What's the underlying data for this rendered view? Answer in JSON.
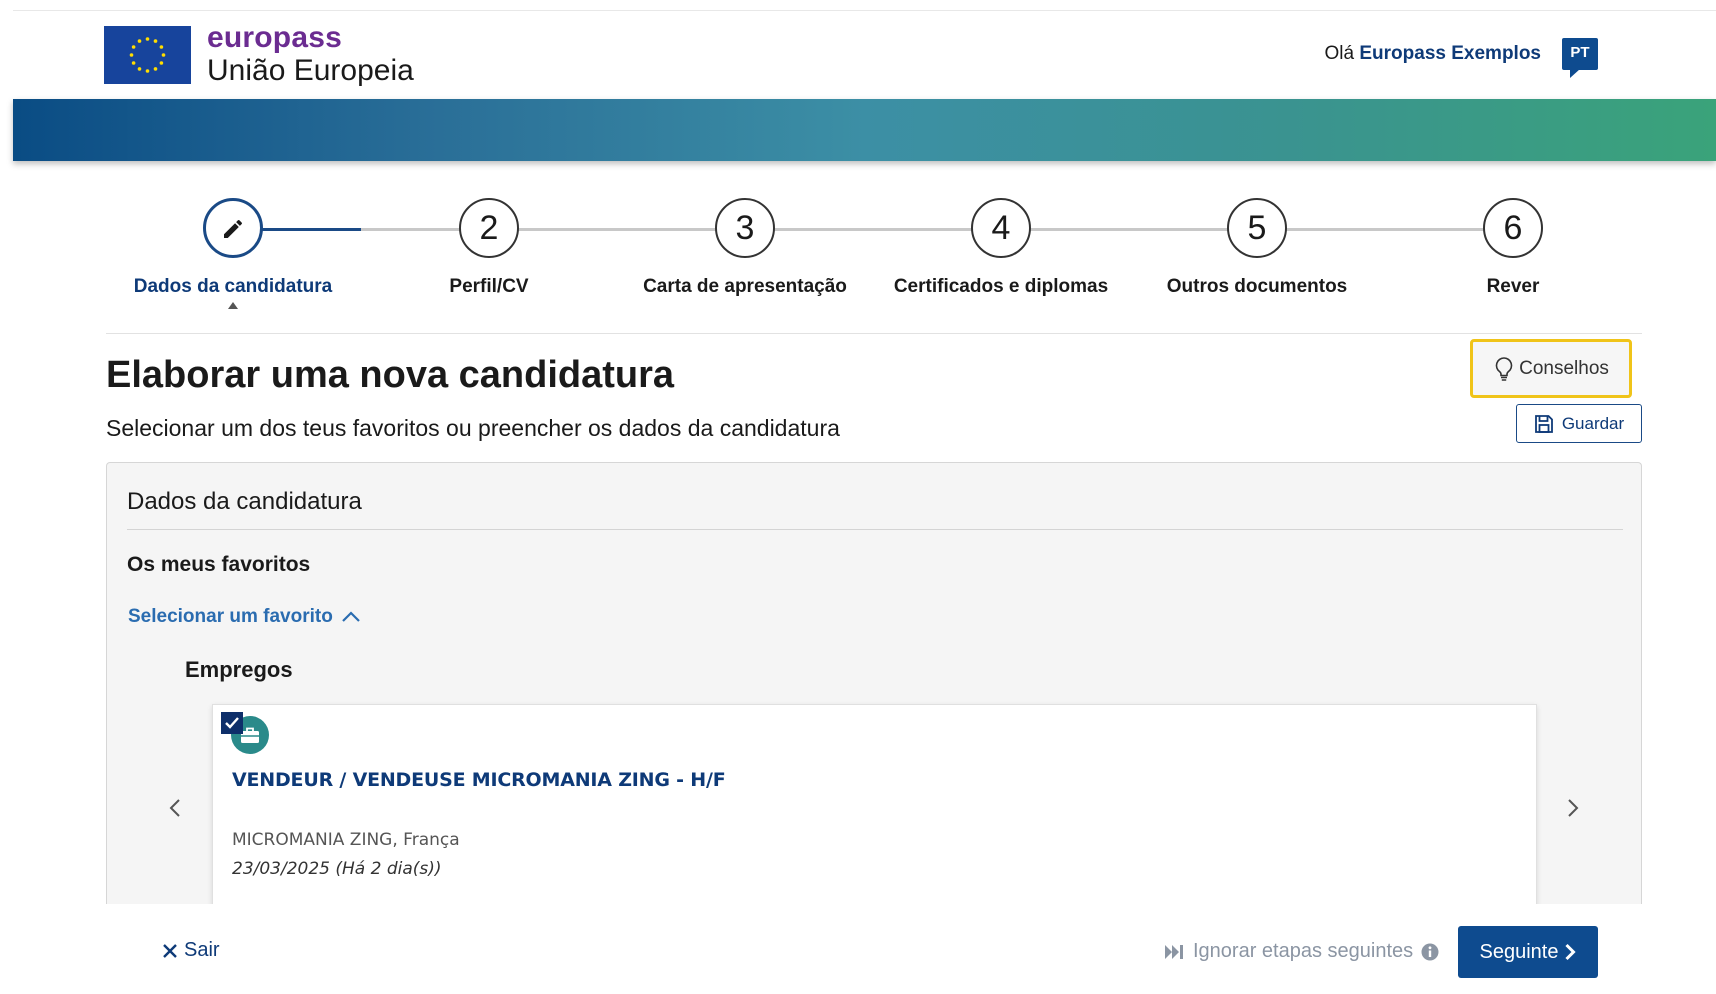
{
  "header": {
    "brand_name": "europass",
    "brand_sub": "União Europeia",
    "greeting_prefix": "Olá",
    "user_name": "Europass Exemplos",
    "language": "PT"
  },
  "stepper": {
    "steps": [
      {
        "number": "",
        "label": "Dados da candidatura"
      },
      {
        "number": "2",
        "label": "Perfil/CV"
      },
      {
        "number": "3",
        "label": "Carta de apresentação"
      },
      {
        "number": "4",
        "label": "Certificados e diplomas"
      },
      {
        "number": "5",
        "label": "Outros documentos"
      },
      {
        "number": "6",
        "label": "Rever"
      }
    ]
  },
  "main": {
    "title": "Elaborar uma nova candidatura",
    "subtitle": "Selecionar um dos teus favoritos ou preencher os dados da candidatura",
    "tips_label": "Conselhos",
    "save_label": "Guardar"
  },
  "panel": {
    "title": "Dados da candidatura",
    "favorites_heading": "Os meus favoritos",
    "select_favorite": "Selecionar um favorito",
    "jobs_heading": "Empregos",
    "job": {
      "title": "VENDEUR / VENDEUSE MICROMANIA ZING - H/F",
      "company": "MICROMANIA ZING, França",
      "date": "23/03/2025 (Há 2 dia(s))",
      "checked": true
    }
  },
  "footer": {
    "exit_label": "Sair",
    "skip_label": "Ignorar etapas seguintes",
    "next_label": "Seguinte"
  },
  "colors": {
    "brand_purple": "#6b2c91",
    "primary_blue": "#0e4b8f",
    "tips_border": "#f0c419"
  }
}
